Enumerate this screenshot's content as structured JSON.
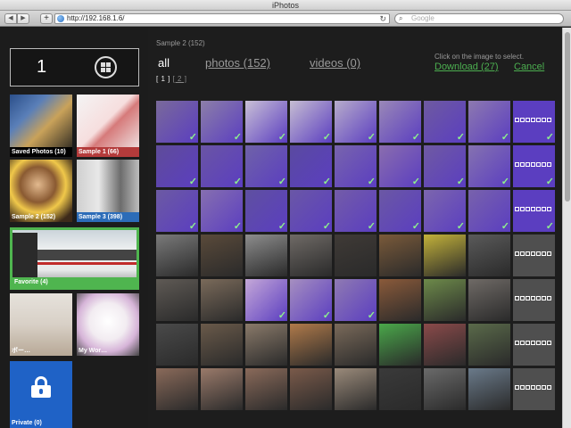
{
  "window": {
    "title": "iPhotos"
  },
  "browser": {
    "back_icon": "◀",
    "forward_icon": "▶",
    "add_icon": "+",
    "url": "http://192.168.1.6/",
    "reload_icon": "↻",
    "search_icon": "⌕",
    "search_placeholder": "Google"
  },
  "sidebar": {
    "selected_count": "1",
    "albums": [
      {
        "label": "Saved Photos (10)"
      },
      {
        "label": "Sample 1 (66)"
      },
      {
        "label": "Sample 2 (152)"
      },
      {
        "label": "Sample 3 (398)"
      },
      {
        "label": "Favorite (4)"
      },
      {
        "label": "ボー…"
      },
      {
        "label": "My Wor…"
      },
      {
        "label": "Private (0)"
      }
    ]
  },
  "main": {
    "breadcrumb": "Sample 2 (152)",
    "tabs": {
      "all": "all",
      "photos": "photos (152)",
      "videos": "videos (0)"
    },
    "pager": {
      "current": "[ 1 ]",
      "next": "[ 2 ]"
    },
    "hint": "Click on the image to select.",
    "download": "Download (27)",
    "cancel": "Cancel",
    "checkmark": "✓",
    "grid": {
      "columns": 9,
      "selected_color": "#5b3ec0",
      "cells": [
        "S",
        "S",
        "S",
        "S",
        "S",
        "S",
        "S",
        "S",
        "P",
        "S",
        "S",
        "S",
        "S",
        "S",
        "S",
        "S",
        "S",
        "P",
        "S",
        "S",
        "S",
        "S",
        "S",
        "S",
        "S",
        "S",
        "P",
        "N",
        "N",
        "N",
        "N",
        "N",
        "N",
        "N",
        "N",
        "Q",
        "N",
        "N",
        "S",
        "S",
        "S",
        "N",
        "N",
        "N",
        "Q",
        "N",
        "N",
        "N",
        "N",
        "N",
        "N",
        "N",
        "N",
        "Q",
        "N",
        "N",
        "N",
        "N",
        "N",
        "N",
        "N",
        "N",
        "Q"
      ],
      "photo_tones": [
        "#7a6a9a",
        "#8c7fa8",
        "#c9c0d6",
        "#c6bdd2",
        "#b7accb",
        "#9a88b7",
        "#6e5aa0",
        "#8d79b0",
        "#4f4f4f",
        "#5f4c99",
        "#6a55a4",
        "#6f62a8",
        "#5a4aa0",
        "#7864ad",
        "#8a6dae",
        "#6f5aa2",
        "#8572b0",
        "#4f4f4f",
        "#6c5aa3",
        "#866fb0",
        "#5f50a0",
        "#6a57a6",
        "#735ca8",
        "#6b58a4",
        "#7c66ad",
        "#7862ac",
        "#4f4f4f",
        "#7a7a7a",
        "#5a4a3a",
        "#8d8d8d",
        "#6f6a66",
        "#3f3a36",
        "#7a5a3a",
        "#c3b23a",
        "#5a5a5a",
        "#4f4f4f",
        "#5f5a55",
        "#7a6a5a",
        "#c5a8d8",
        "#a68fc0",
        "#8f7ab2",
        "#8a5a3a",
        "#6d8a4a",
        "#6f6a66",
        "#4f4f4f",
        "#4a4a4a",
        "#6a5a4a",
        "#8a7a6a",
        "#b07a4a",
        "#7a6a5a",
        "#4aa84a",
        "#8a4a4a",
        "#5a6a4a",
        "#4f4f4f",
        "#8a6a5a",
        "#9a7a6a",
        "#8a6a5a",
        "#7a5a4a",
        "#9a8a7a",
        "#3a3a3a",
        "#6a6a6a",
        "#6a7a8a",
        "#4f4f4f"
      ]
    }
  }
}
